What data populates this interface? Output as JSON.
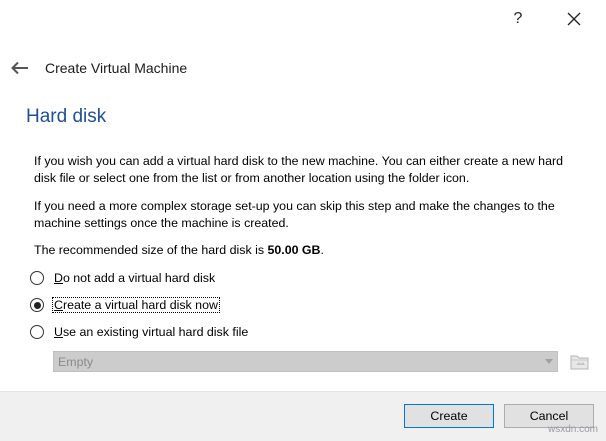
{
  "titlebar": {
    "help_label": "?"
  },
  "header": {
    "title": "Create Virtual Machine"
  },
  "section": {
    "title": "Hard disk"
  },
  "paragraphs": {
    "p1": "If you wish you can add a virtual hard disk to the new machine. You can either create a new hard disk file or select one from the list or from another location using the folder icon.",
    "p2": "If you need a more complex storage set-up you can skip this step and make the changes to the machine settings once the machine is created.",
    "p3_prefix": "The recommended size of the hard disk is ",
    "p3_size": "50.00 GB",
    "p3_suffix": "."
  },
  "options": [
    {
      "mnemonic": "D",
      "rest": "o not add a virtual hard disk",
      "selected": false
    },
    {
      "mnemonic": "C",
      "rest": "reate a virtual hard disk now",
      "selected": true
    },
    {
      "mnemonic": "U",
      "rest": "se an existing virtual hard disk file",
      "selected": false
    }
  ],
  "disk_select": {
    "value": "Empty",
    "enabled": false
  },
  "buttons": {
    "create": "Create",
    "cancel": "Cancel"
  },
  "watermark": "wsxdn.com"
}
